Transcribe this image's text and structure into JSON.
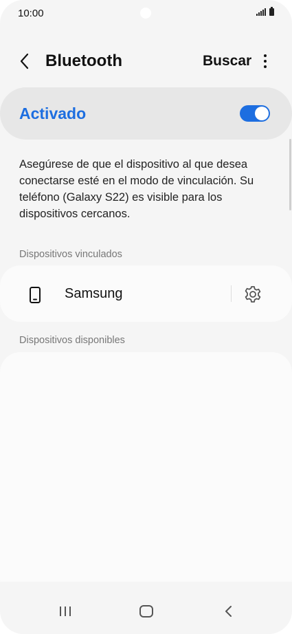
{
  "status_bar": {
    "time": "10:00"
  },
  "app_bar": {
    "title": "Bluetooth",
    "scan_label": "Buscar"
  },
  "master_switch": {
    "label": "Activado",
    "on": true
  },
  "description": "Asegúrese de que el dispositivo al que desea conectarse esté en el modo de vinculación. Su teléfono (Galaxy S22) es visible para los dispositivos cercanos.",
  "paired": {
    "header": "Dispositivos vinculados",
    "devices": [
      {
        "name": "Samsung",
        "icon": "phone-icon"
      }
    ]
  },
  "available": {
    "header": "Dispositivos disponibles",
    "devices": []
  },
  "colors": {
    "accent": "#1d6ee0",
    "background": "#f5f5f5",
    "card": "#fbfbfb"
  },
  "nav_bar": {
    "icons": [
      "recent-apps-icon",
      "home-icon",
      "back-icon"
    ]
  }
}
